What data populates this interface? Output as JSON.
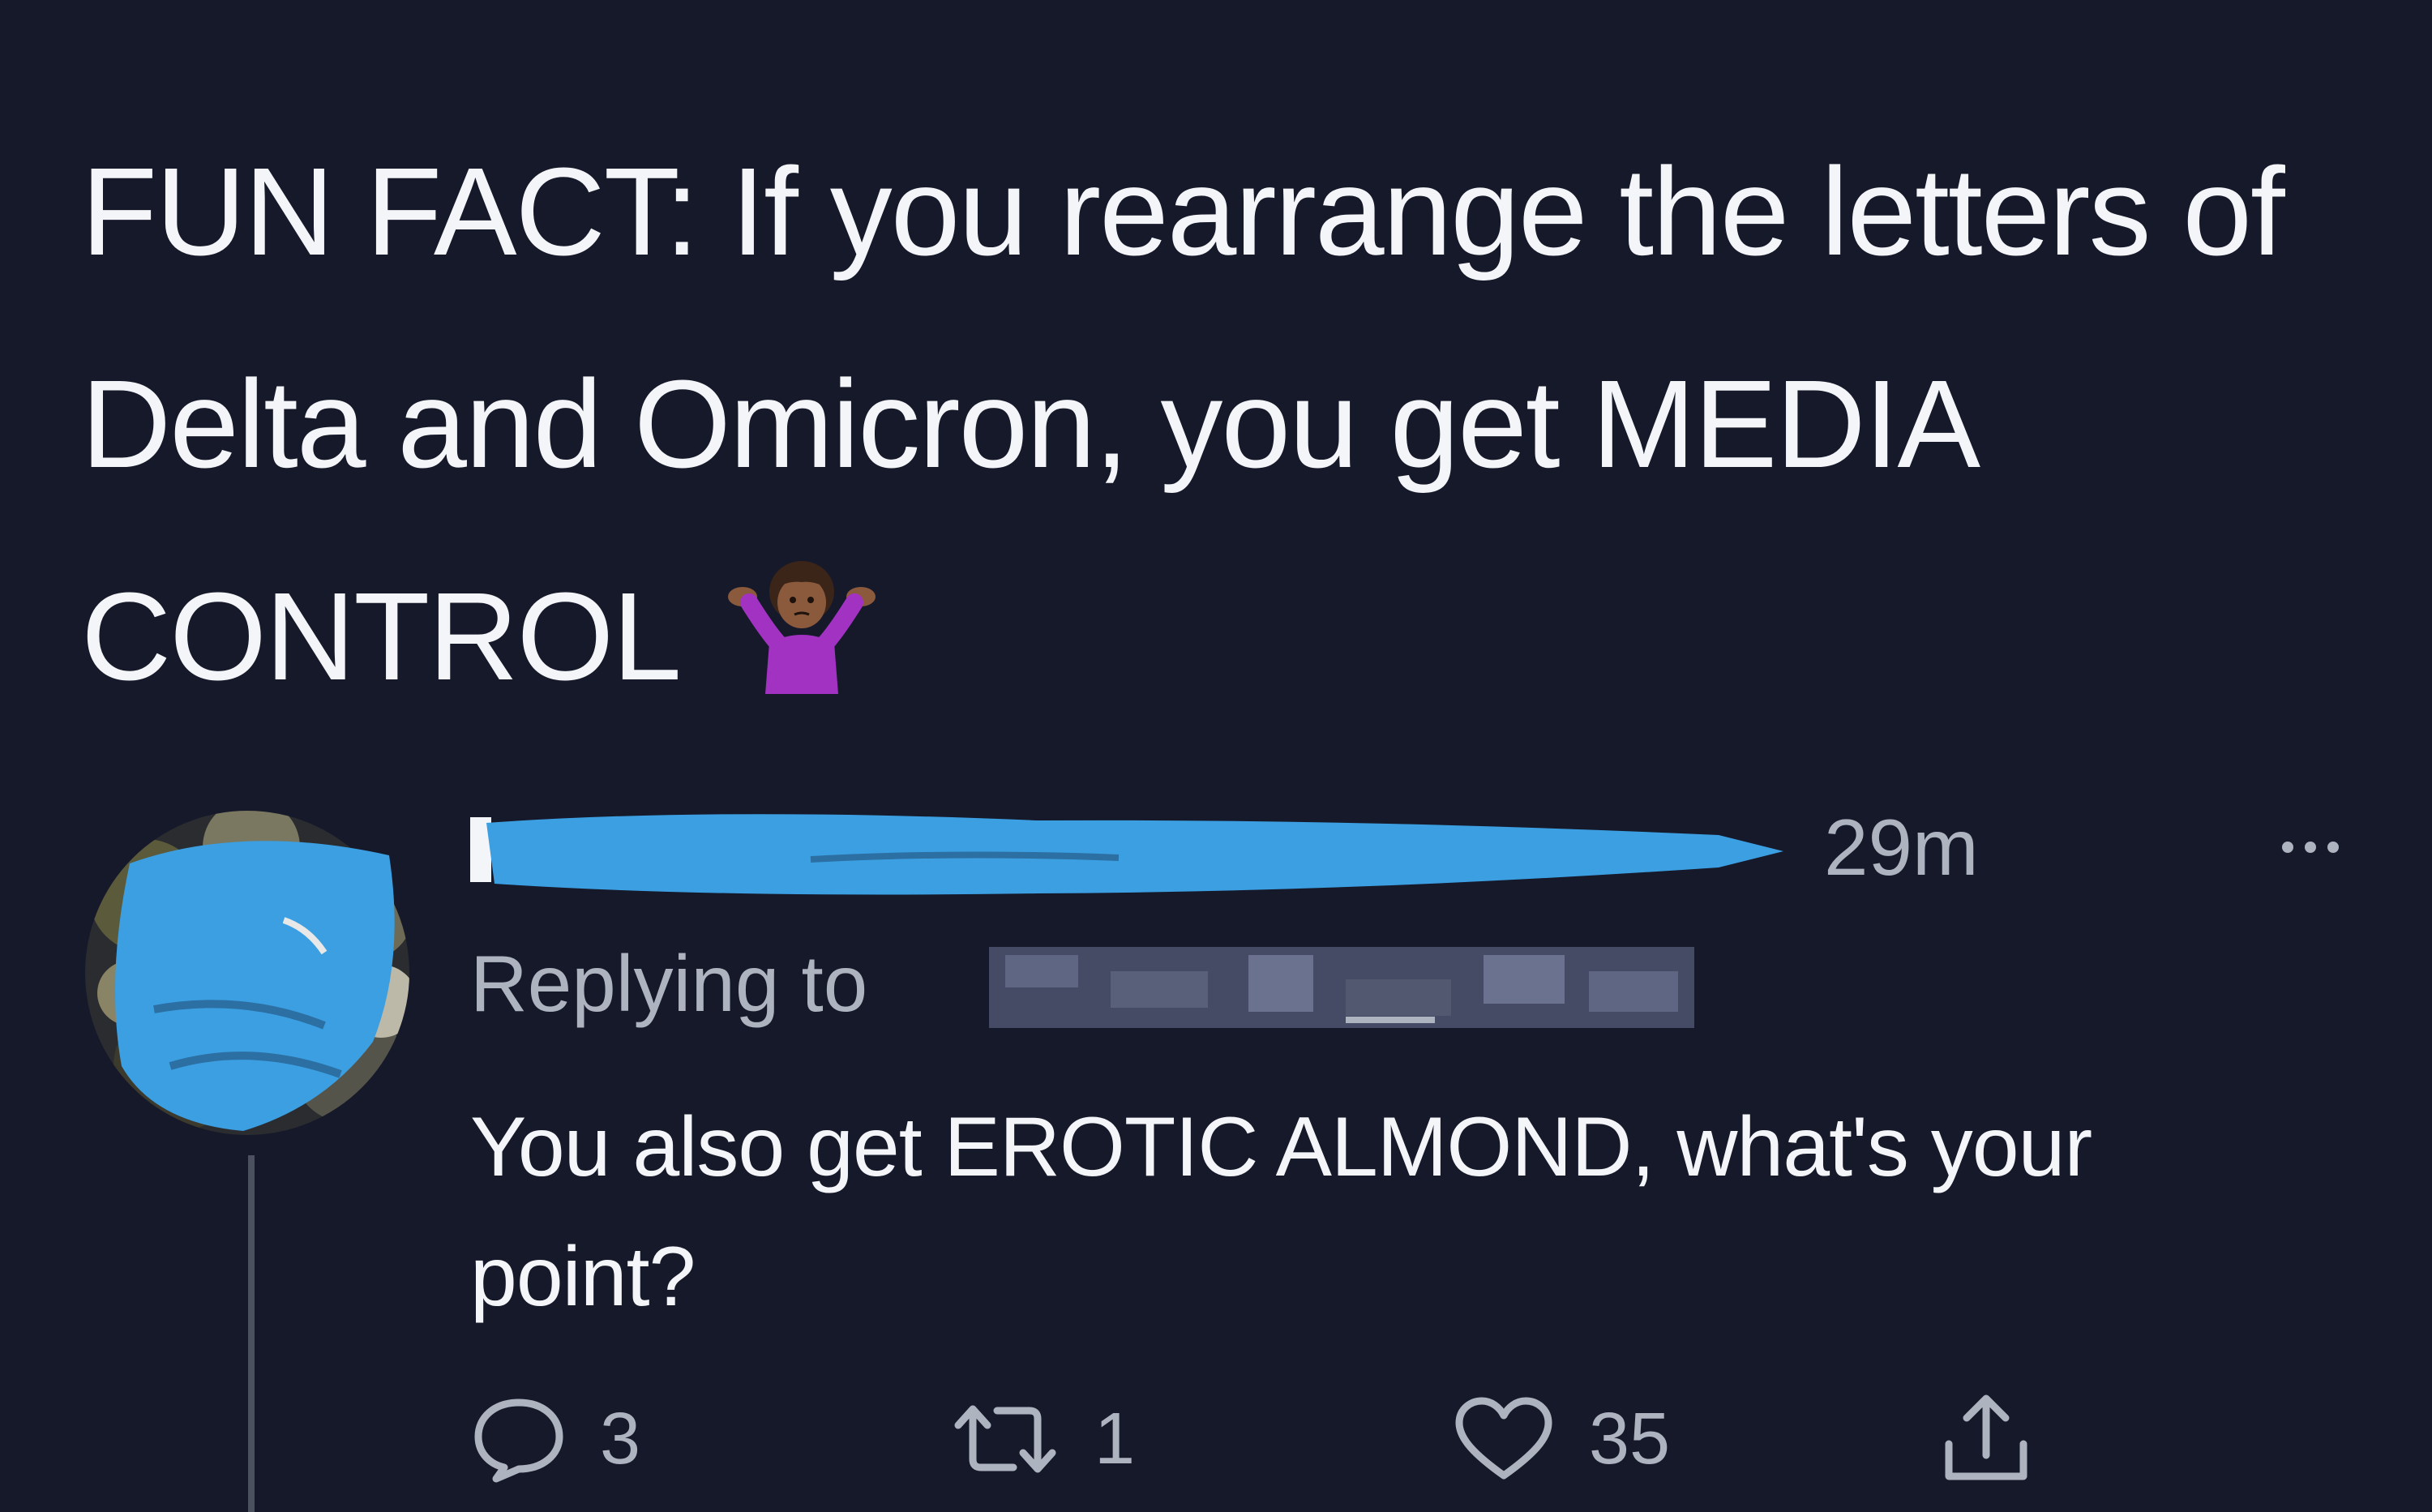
{
  "main_tweet": {
    "text": "FUN FACT: If you rearrange the letters of Delta and Omicron, you get MEDIA CONTROL",
    "emoji_icon": "person-shrugging-icon"
  },
  "reply": {
    "timestamp": "29m",
    "replying_to_label": "Replying to",
    "text": "You also get EROTIC ALMOND, what's your point?",
    "more_icon": "more-options-icon",
    "actions": {
      "reply_icon": "speech-bubble-icon",
      "reply_count": "3",
      "retweet_icon": "retweet-icon",
      "retweet_count": "1",
      "like_icon": "heart-icon",
      "like_count": "35",
      "share_icon": "share-icon"
    }
  },
  "colors": {
    "background": "#16192a",
    "text_primary": "#f4f5f8",
    "text_secondary": "#aeb3c0",
    "redaction_blue": "#3b9fe2"
  }
}
